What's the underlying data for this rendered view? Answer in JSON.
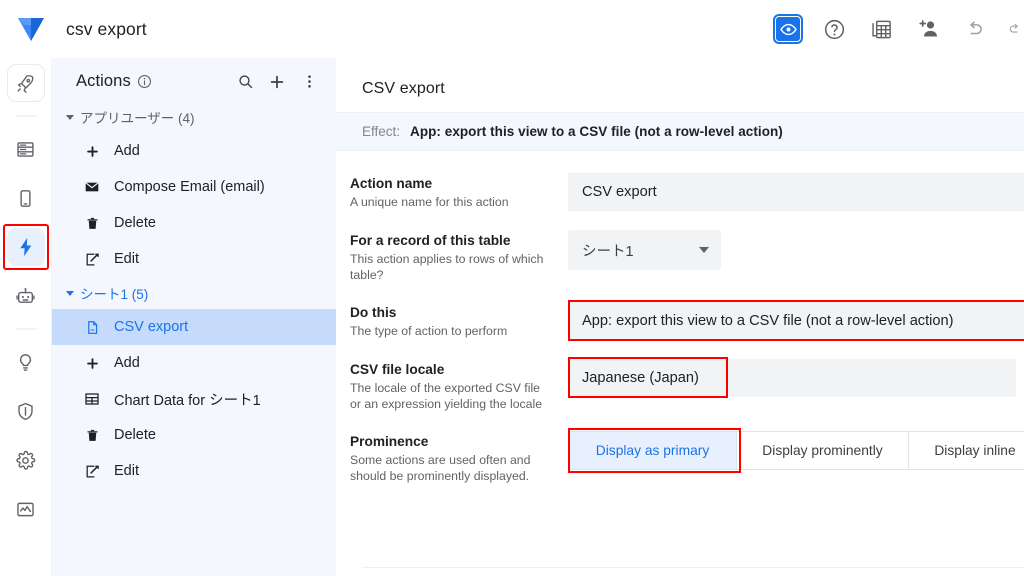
{
  "topbar": {
    "app_title": "csv export",
    "logo_name": "appsheet-logo",
    "icons": [
      {
        "name": "preview-eye-icon",
        "label": "Preview app"
      },
      {
        "name": "help-question-icon",
        "label": "Help"
      },
      {
        "name": "data-table-icon",
        "label": "Data source"
      },
      {
        "name": "add-user-icon",
        "label": "Share app"
      },
      {
        "name": "undo-icon",
        "label": "Undo"
      },
      {
        "name": "redo-icon",
        "label": "Redo"
      }
    ]
  },
  "rail": {
    "items": [
      {
        "name": "rail-item-rocket",
        "icon": "rocket-icon",
        "active": false,
        "boxed": true
      },
      {
        "name": "rail-item-data",
        "icon": "data-list-icon",
        "active": false,
        "boxed": false
      },
      {
        "name": "rail-item-app",
        "icon": "mobile-device-icon",
        "active": false,
        "boxed": false
      },
      {
        "name": "rail-item-automation",
        "icon": "lightning-bolt-icon",
        "active": true,
        "boxed": false
      },
      {
        "name": "rail-item-intelligence",
        "icon": "robot-icon",
        "active": false,
        "boxed": false
      },
      {
        "name": "rail-item-ideas",
        "icon": "lightbulb-icon",
        "active": false,
        "boxed": false
      },
      {
        "name": "rail-item-security",
        "icon": "shield-icon",
        "active": false,
        "boxed": false
      },
      {
        "name": "rail-item-settings",
        "icon": "gear-icon",
        "active": false,
        "boxed": false
      },
      {
        "name": "rail-item-monitor",
        "icon": "monitor-chart-icon",
        "active": false,
        "boxed": false
      }
    ]
  },
  "actions_panel": {
    "title": "Actions",
    "info_icon": "info-circle-icon",
    "header_icons": [
      {
        "name": "search-icon"
      },
      {
        "name": "plus-icon"
      },
      {
        "name": "more-vertical-icon"
      }
    ],
    "groups": [
      {
        "label": "アプリユーザー (4)",
        "blue": false,
        "items": [
          {
            "label": "Add",
            "icon": "plus-icon",
            "selected": false
          },
          {
            "label": "Compose Email (email)",
            "icon": "envelope-icon",
            "selected": false
          },
          {
            "label": "Delete",
            "icon": "trash-icon",
            "selected": false
          },
          {
            "label": "Edit",
            "icon": "pencil-square-icon",
            "selected": false
          }
        ]
      },
      {
        "label": "シート1 (5)",
        "blue": true,
        "items": [
          {
            "label": "CSV export",
            "icon": "document-icon",
            "selected": true
          },
          {
            "label": "Add",
            "icon": "plus-icon",
            "selected": false
          },
          {
            "label": "Chart Data for シート1",
            "icon": "grid-table-icon",
            "selected": false
          },
          {
            "label": "Delete",
            "icon": "trash-icon",
            "selected": false
          },
          {
            "label": "Edit",
            "icon": "pencil-square-icon",
            "selected": false
          }
        ]
      }
    ]
  },
  "main": {
    "heading": "CSV export",
    "effect_key": "Effect:",
    "effect_value": "App: export this view to a CSV file (not a row-level action)",
    "fields": {
      "action_name": {
        "title": "Action name",
        "desc": "A unique name for this action",
        "value": "CSV export"
      },
      "table": {
        "title": "For a record of this table",
        "desc": "This action applies to rows of which table?",
        "value": "シート1"
      },
      "do_this": {
        "title": "Do this",
        "desc": "The type of action to perform",
        "value": "App: export this view to a CSV file (not a row-level action)"
      },
      "locale": {
        "title": "CSV file locale",
        "desc": "The locale of the exported CSV file or an expression yielding the locale",
        "value": "Japanese (Japan)"
      },
      "prominence": {
        "title": "Prominence",
        "desc": "Some actions are used often and should be prominently displayed.",
        "options": [
          {
            "label": "Display as primary",
            "active": true
          },
          {
            "label": "Display prominently",
            "active": false
          },
          {
            "label": "Display inline",
            "active": false
          }
        ]
      }
    }
  },
  "colors": {
    "accent_blue": "#1a73e8",
    "highlight_red": "#ff0000",
    "selected_row": "#c6dafc",
    "panel_bg": "#f4f7fd",
    "input_bg": "#f1f3f4"
  }
}
